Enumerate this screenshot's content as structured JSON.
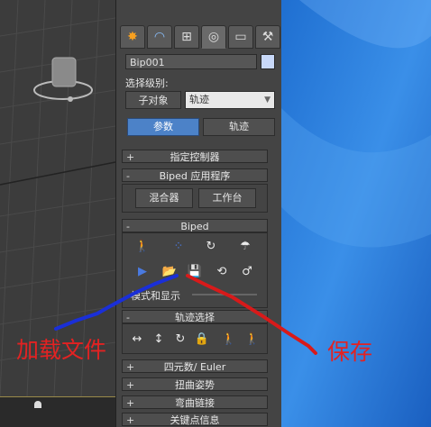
{
  "object": {
    "name": "Bip001",
    "color": "#c8d8f8"
  },
  "selection": {
    "level_label": "选择级别:",
    "subobject_label": "子对象",
    "level_value": "轨迹"
  },
  "modes": {
    "params_label": "参数",
    "trajectory_label": "轨迹"
  },
  "rollouts": {
    "controller": "指定控制器",
    "biped_app": "Biped 应用程序",
    "mixer": "混合器",
    "workbench": "工作台",
    "biped": "Biped",
    "mode_display": "模式和显示",
    "track_select": "轨迹选择",
    "quaternion": "四元数/ Euler",
    "twist": "扭曲姿势",
    "bend": "弯曲链接",
    "keyinfo": "关键点信息"
  },
  "annotations": {
    "load_file": "加载文件",
    "save": "保存"
  },
  "accent_colors": {
    "active_button": "#4c82c8",
    "annotation_red": "#e32222",
    "annotation_blue": "#1a2fd8"
  }
}
